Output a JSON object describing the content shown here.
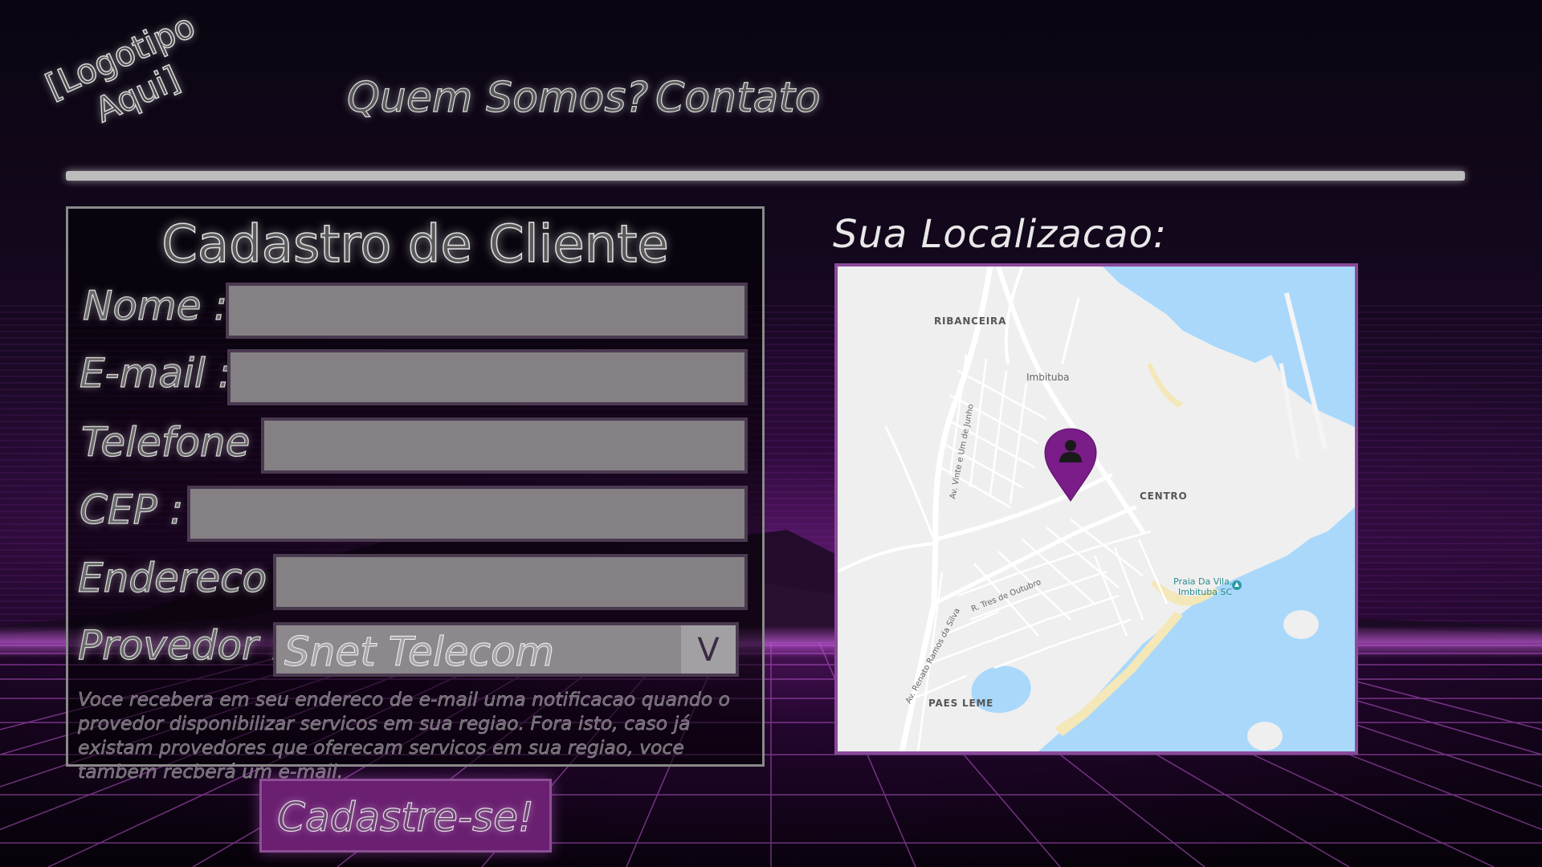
{
  "header": {
    "logo_line1": "[Logotipo",
    "logo_line2": "Aqui]",
    "nav": [
      "Quem Somos?",
      "Contato"
    ]
  },
  "form": {
    "title": "Cadastro de Cliente",
    "fields": [
      {
        "label": "Nome :",
        "value": ""
      },
      {
        "label": "E-mail :",
        "value": ""
      },
      {
        "label": "Telefone :",
        "value": ""
      },
      {
        "label": "CEP :",
        "value": ""
      },
      {
        "label": "Endereco :",
        "value": ""
      }
    ],
    "provider_label": "Provedor :",
    "provider_value": "Snet Telecom",
    "provider_arrow": "V",
    "note": "Voce recebera em seu endereco de e-mail uma notificacao quando o provedor disponibilizar servicos em sua regiao. Fora isto, caso já existam provedores que oferecam servicos em sua regiao, voce tambem recberá um e-mail.",
    "submit_label": "Cadastre-se!"
  },
  "location": {
    "title": "Sua Localizacao:",
    "map": {
      "places": {
        "ribanceira": "RIBANCEIRA",
        "imbituba": "Imbituba",
        "centro": "CENTRO",
        "paes_leme": "PAES LEME",
        "praia_line1": "Praia Da Vila,",
        "praia_line2": "Imbituba SC"
      },
      "streets": {
        "vinte_junho": "Av. Vinte e Um de Junho",
        "tres_outubro": "R. Tres de Outubro",
        "renato_ramos": "Av. Renato Ramos da Silva"
      }
    }
  },
  "colors": {
    "accent_purple": "#7a1d88",
    "button_purple": "#6a1f70",
    "water": "#a9d8fb",
    "land": "#efefef"
  },
  "icons": [
    "location-pin-icon",
    "person-icon",
    "beach-icon",
    "chevron-down-icon"
  ]
}
